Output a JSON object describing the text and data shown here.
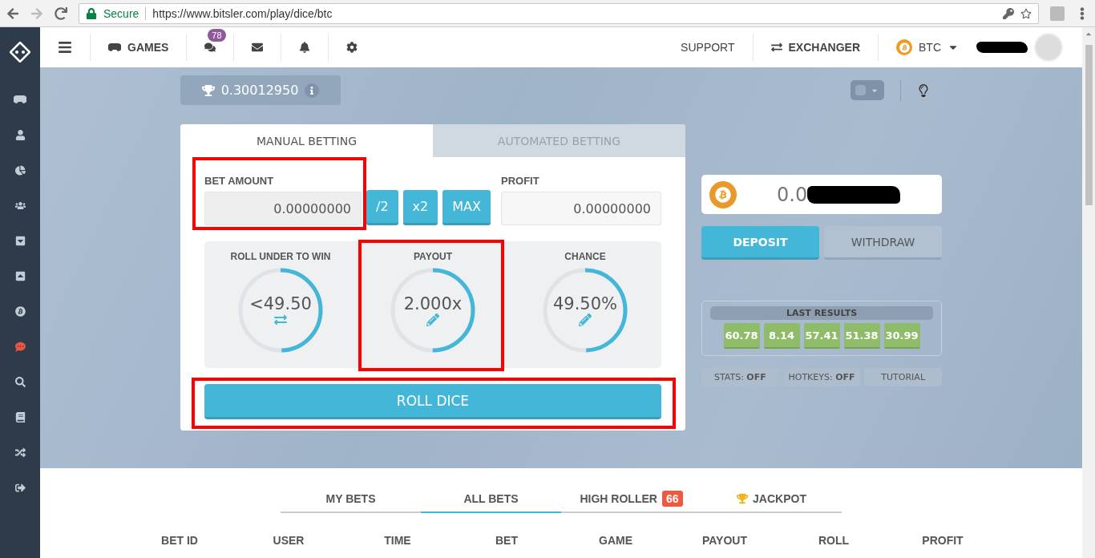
{
  "browser": {
    "security": "Secure",
    "url": "https://www.bitsler.com/play/dice/btc"
  },
  "sidebar": {
    "items": [
      {
        "active": false
      },
      {
        "active": false
      },
      {
        "active": false
      },
      {
        "active": false
      },
      {
        "active": false
      },
      {
        "active": false
      },
      {
        "active": false
      },
      {
        "active": true
      },
      {
        "active": false
      },
      {
        "active": false
      },
      {
        "active": false
      },
      {
        "active": false
      }
    ]
  },
  "theme_toggle": {
    "on": false
  },
  "topnav": {
    "games": "GAMES",
    "chat_badge": "78",
    "support": "SUPPORT",
    "exchanger": "EXCHANGER",
    "currency": "BTC",
    "username_redacted": true
  },
  "jackpot_pill": {
    "amount": "0.30012950"
  },
  "betting": {
    "tabs": [
      {
        "label": "MANUAL BETTING",
        "selected": true
      },
      {
        "label": "AUTOMATED BETTING",
        "selected": false
      }
    ],
    "bet_amount": {
      "label": "BET AMOUNT",
      "value": "0.00000000",
      "highlighted": true
    },
    "buttons": [
      "/2",
      "x2",
      "MAX"
    ],
    "profit": {
      "label": "PROFIT",
      "value": "0.00000000"
    },
    "gauges": [
      {
        "label": "ROLL UNDER TO WIN",
        "value": "<49.50",
        "level": 0.495,
        "kind": "swap",
        "highlighted": false
      },
      {
        "label": "PAYOUT",
        "value": "2.000x",
        "level": 0.5,
        "kind": "edit",
        "highlighted": true
      },
      {
        "label": "CHANCE",
        "value": "49.50%",
        "level": 0.495,
        "kind": "edit",
        "highlighted": false
      }
    ],
    "roll": {
      "label": "ROLL DICE",
      "highlighted": true
    }
  },
  "wallet": {
    "balance": "0.0",
    "redacted": true,
    "deposit": "DEPOSIT",
    "withdraw": "WITHDRAW"
  },
  "last_results": {
    "title": "LAST RESULTS",
    "values": [
      "60.78",
      "8.14",
      "57.41",
      "51.38",
      "30.99"
    ]
  },
  "toggles": [
    {
      "label": "STATS: **OFF**"
    },
    {
      "label": "HOTKEYS: **OFF**"
    },
    {
      "label": "TUTORIAL"
    }
  ],
  "bets_tabs": [
    {
      "label": "MY BETS",
      "selected": false
    },
    {
      "label": "ALL BETS",
      "selected": true
    },
    {
      "label": "HIGH ROLLER",
      "selected": false,
      "badge": "66"
    },
    {
      "label": "JACKPOT",
      "selected": false,
      "kind": "prize"
    }
  ],
  "table": {
    "columns": [
      "BET ID",
      "USER",
      "TIME",
      "BET",
      "GAME",
      "PAYOUT",
      "ROLL",
      "PROFIT"
    ]
  }
}
